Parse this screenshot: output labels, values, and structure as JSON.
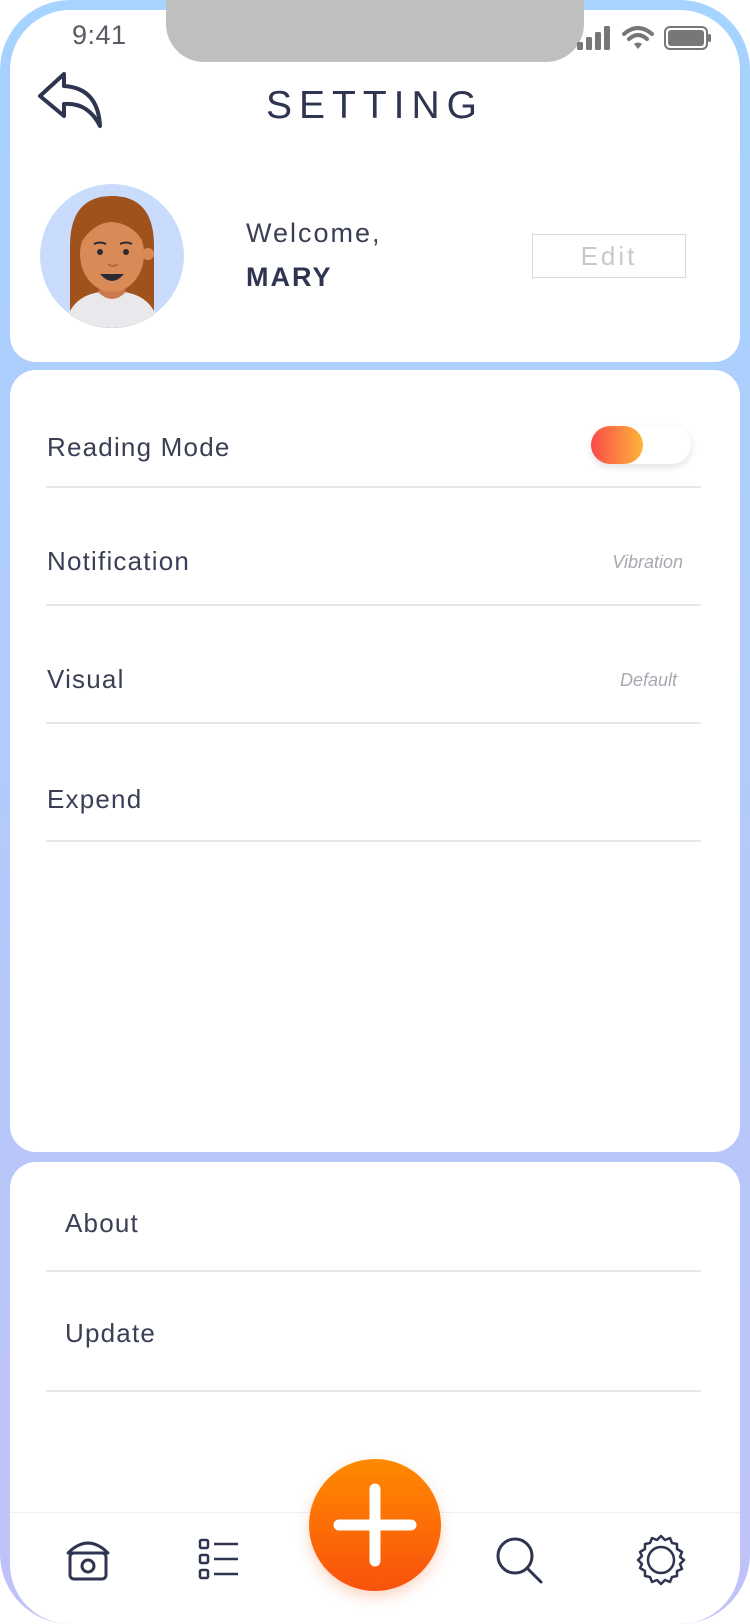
{
  "status_bar": {
    "time": "9:41"
  },
  "header": {
    "title": "SETTING"
  },
  "profile": {
    "greeting": "Welcome,",
    "name": "MARY",
    "edit_label": "Edit"
  },
  "settings": [
    {
      "label": "Reading Mode",
      "control": "toggle",
      "enabled": true
    },
    {
      "label": "Notification",
      "value": "Vibration"
    },
    {
      "label": "Visual",
      "value": "Default"
    },
    {
      "label": "Expend",
      "value": ""
    }
  ],
  "info": [
    {
      "label": "About"
    },
    {
      "label": "Update"
    }
  ],
  "tab_bar": {
    "items": [
      "home-icon",
      "list-icon",
      "add-icon",
      "search-icon",
      "gear-icon"
    ],
    "accent": "#f9520d"
  }
}
